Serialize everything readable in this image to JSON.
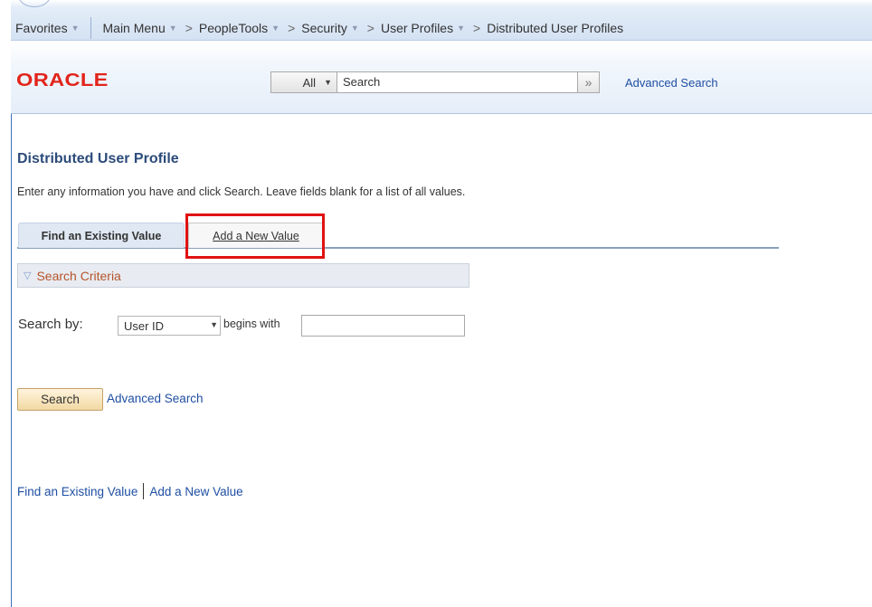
{
  "nav": {
    "favorites": "Favorites",
    "main_menu": "Main Menu",
    "crumbs": [
      "PeopleTools",
      "Security",
      "User Profiles",
      "Distributed User Profiles"
    ]
  },
  "header": {
    "logo": "ORACLE",
    "scope": "All",
    "search_value": "Search",
    "advanced_search": "Advanced Search"
  },
  "page": {
    "title": "Distributed User Profile",
    "instructions": "Enter any information you have and click Search. Leave fields blank for a list of all values.",
    "tabs": {
      "find": "Find an Existing Value",
      "add": "Add a New Value"
    },
    "criteria_label": "Search Criteria",
    "search_by_label": "Search by:",
    "search_field": "User ID",
    "operator": "begins with",
    "search_value": "",
    "search_button": "Search",
    "advanced_search_link": "Advanced Search",
    "bottom_find": "Find an Existing Value",
    "bottom_add": "Add a New Value"
  },
  "colors": {
    "accent": "#e01212",
    "brand": "#e2241b",
    "link": "#1f4fa3"
  }
}
